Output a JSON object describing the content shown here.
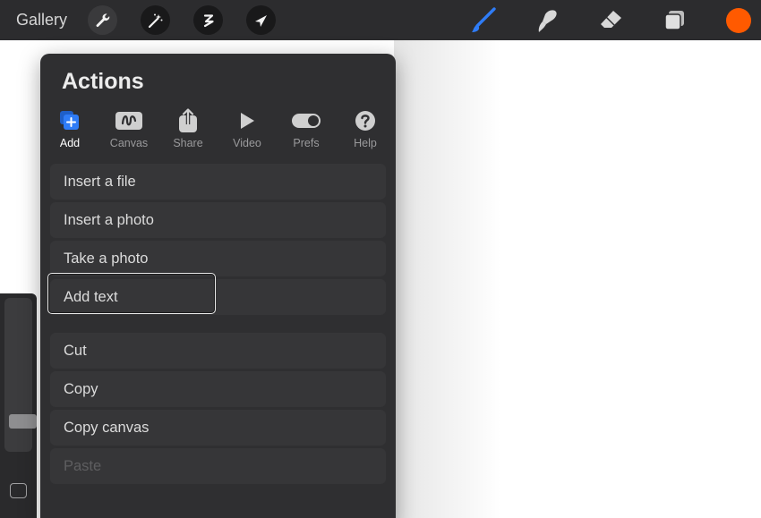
{
  "topbar": {
    "gallery_label": "Gallery",
    "tools_left": [
      {
        "name": "wrench-icon",
        "active": true
      },
      {
        "name": "magic-wand-icon",
        "active": false
      },
      {
        "name": "selection-icon",
        "active": false
      },
      {
        "name": "transform-arrow-icon",
        "active": false
      }
    ],
    "tools_right": [
      "brush-icon",
      "smudge-icon",
      "eraser-icon",
      "layers-icon"
    ],
    "current_color": "#ff5a00",
    "accent_color": "#2f7cf6"
  },
  "panel": {
    "title": "Actions",
    "tabs": [
      {
        "label": "Add",
        "icon": "add-icon",
        "active": true
      },
      {
        "label": "Canvas",
        "icon": "canvas-icon",
        "active": false
      },
      {
        "label": "Share",
        "icon": "share-icon",
        "active": false
      },
      {
        "label": "Video",
        "icon": "video-play-icon",
        "active": false
      },
      {
        "label": "Prefs",
        "icon": "prefs-toggle-icon",
        "active": false
      },
      {
        "label": "Help",
        "icon": "help-icon",
        "active": false
      }
    ],
    "items_group1": [
      "Insert a file",
      "Insert a photo",
      "Take a photo",
      "Add text"
    ],
    "items_group2": [
      "Cut",
      "Copy",
      "Copy canvas",
      "Paste"
    ],
    "disabled_items": [
      "Paste"
    ],
    "highlighted_item": "Add text"
  },
  "sidebar": {
    "brush_size_level": 0.24
  }
}
